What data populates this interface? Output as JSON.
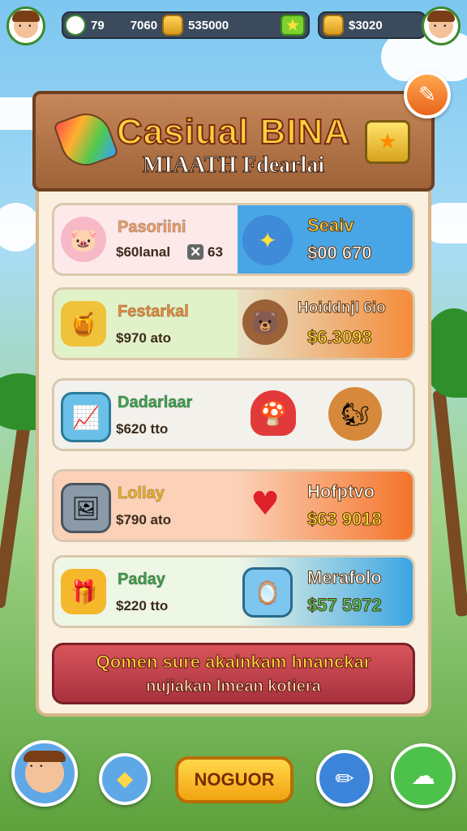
{
  "hud": {
    "stat1": "79",
    "stat2": "7060",
    "stat3": "535000",
    "stat4": "$3020",
    "star_icon": "star-icon",
    "coin_icon": "coin-icon"
  },
  "sign": {
    "title": "Casiual BINA",
    "subtitle": "MIAATH Fdearlai"
  },
  "rows": [
    {
      "label": "Pasoriini",
      "value": "$60lanal",
      "value_extra": "63",
      "right_label": "Seaiv",
      "right_value": "$00 670",
      "left_color": "#fde9e9",
      "right_color": "#49a6e6",
      "label_color": "#f3a36b"
    },
    {
      "label": "Festarkal",
      "value": "$970 ato",
      "right_label": "Hoiddnjl 6io",
      "right_value": "$6.3098",
      "left_color": "#e2f2c8",
      "right_color": "#f48c3a",
      "label_color": "#f08c3a"
    },
    {
      "label": "Dadarlaar",
      "value": "$620 tto",
      "right_label": "",
      "right_value": "",
      "left_color": "#f3f1ec",
      "right_color": "#f3f1ec",
      "label_color": "#3aa64a"
    },
    {
      "label": "Lollay",
      "value": "$790 ato",
      "right_label": "Hofptvo",
      "right_value": "$63 9018",
      "left_color": "#fbd1b7",
      "right_color": "#f4742a",
      "label_color": "#f2b52a"
    },
    {
      "label": "Paday",
      "value": "$220 tto",
      "right_label": "Merafolo",
      "right_value": "$57 5972",
      "left_color": "#eef6e6",
      "right_color": "#3ba5e2",
      "label_color": "#3fa14a"
    }
  ],
  "banner": {
    "line1": "Qomen sure akainkam hnanckar",
    "line2": "nujiakan lmean kotiera"
  },
  "bottom": {
    "main_button": "NOGUOR"
  }
}
